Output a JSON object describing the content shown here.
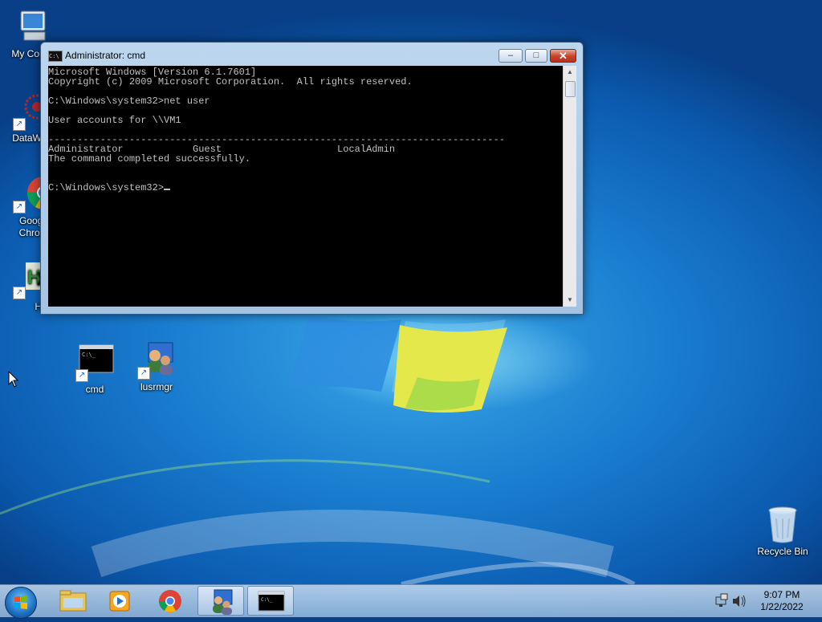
{
  "desktop": {
    "icons": [
      {
        "id": "my-computer",
        "label": "My Comp"
      },
      {
        "id": "datawag",
        "label": "DataWag"
      },
      {
        "id": "chrome",
        "label": "Googl Chron"
      },
      {
        "id": "hxd",
        "label": "HxD"
      },
      {
        "id": "cmd",
        "label": "cmd"
      },
      {
        "id": "lusrmgr",
        "label": "lusrmgr"
      },
      {
        "id": "recycle-bin",
        "label": "Recycle Bin"
      }
    ]
  },
  "window": {
    "title": "Administrator: cmd",
    "title_icon_text": "C:\\",
    "buttons": {
      "minimize": "–",
      "maximize": "□",
      "close": "✕"
    },
    "console_lines": [
      "Microsoft Windows [Version 6.1.7601]",
      "Copyright (c) 2009 Microsoft Corporation.  All rights reserved.",
      "",
      "C:\\Windows\\system32>net user",
      "",
      "User accounts for \\\\VM1",
      "",
      "-------------------------------------------------------------------------------",
      "Administrator            Guest                    LocalAdmin",
      "The command completed successfully.",
      "",
      "",
      "C:\\Windows\\system32>"
    ]
  },
  "taskbar": {
    "items": [
      "explorer",
      "media-player",
      "chrome",
      "lusrmgr",
      "cmd"
    ],
    "active": [
      "lusrmgr",
      "cmd"
    ],
    "clock": {
      "time": "9:07 PM",
      "date": "1/22/2022"
    }
  },
  "colors": {
    "console_bg": "#000000",
    "console_fg": "#c0c0c0",
    "desktop": "#1a7dcf"
  }
}
